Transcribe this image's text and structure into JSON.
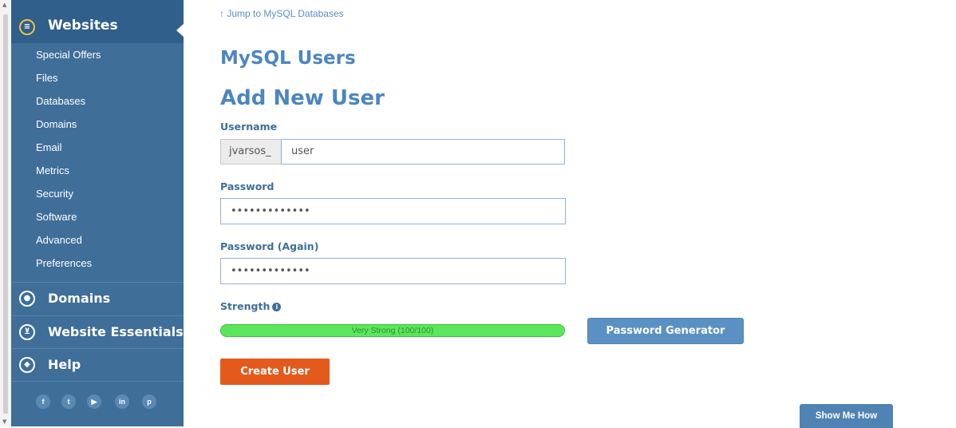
{
  "sidebar": {
    "websites": {
      "label": "Websites",
      "icon": "list-icon"
    },
    "items": [
      {
        "label": "Special Offers"
      },
      {
        "label": "Files"
      },
      {
        "label": "Databases"
      },
      {
        "label": "Domains"
      },
      {
        "label": "Email"
      },
      {
        "label": "Metrics"
      },
      {
        "label": "Security"
      },
      {
        "label": "Software"
      },
      {
        "label": "Advanced"
      },
      {
        "label": "Preferences"
      }
    ],
    "sections": [
      {
        "label": "Domains",
        "icon": "globe-icon"
      },
      {
        "label": "Website Essentials",
        "icon": "cart-icon"
      },
      {
        "label": "Help",
        "icon": "help-icon"
      }
    ],
    "social": [
      "f",
      "t",
      "yt",
      "in",
      "p"
    ]
  },
  "main": {
    "jump_link": "↑ Jump to MySQL Databases",
    "title": "MySQL Users",
    "subtitle": "Add New User",
    "username_label": "Username",
    "username_prefix": "jvarsos_",
    "username_value": "user",
    "password_label": "Password",
    "password_value": "•••••••••••••",
    "password_again_label": "Password (Again)",
    "password_again_value": "•••••••••••••",
    "strength_label": "Strength",
    "strength_text": "Very Strong (100/100)",
    "strength_percent": 100,
    "password_generator_button": "Password Generator",
    "create_user_button": "Create User",
    "show_me_how_button": "Show Me How"
  },
  "colors": {
    "sidebar": "#3f6e99",
    "heading": "#4c86bf",
    "create_button": "#e35a1c",
    "strength_fill": "#5ce65c"
  }
}
